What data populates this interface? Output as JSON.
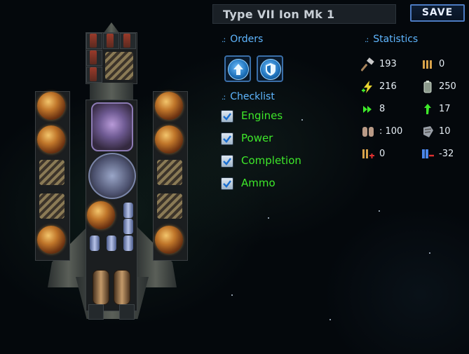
{
  "ship": {
    "name": "Type VII Ion Mk 1"
  },
  "toolbar": {
    "save_label": "SAVE"
  },
  "orders": {
    "title": "Orders",
    "buttons": [
      {
        "icon": "arrow-up-icon"
      },
      {
        "icon": "shield-icon"
      }
    ]
  },
  "checklist": {
    "title": "Checklist",
    "items": [
      {
        "label": "Engines",
        "checked": true
      },
      {
        "label": "Power",
        "checked": true
      },
      {
        "label": "Completion",
        "checked": true
      },
      {
        "label": "Ammo",
        "checked": true
      }
    ]
  },
  "statistics": {
    "title": "Statistics",
    "items": [
      {
        "icon": "hammer-icon",
        "value": "193"
      },
      {
        "icon": "ammo-crate-icon",
        "value": "0"
      },
      {
        "icon": "power-bolt-icon",
        "value": "216"
      },
      {
        "icon": "battery-icon",
        "value": "250"
      },
      {
        "icon": "thrust-chevrons-icon",
        "value": "8"
      },
      {
        "icon": "turn-arrow-icon",
        "value": "17"
      },
      {
        "icon": "armor-plates-icon",
        "value": ": 100"
      },
      {
        "icon": "repair-icon",
        "value": "10"
      },
      {
        "icon": "ammo-drain-icon",
        "value": "0"
      },
      {
        "icon": "power-drain-icon",
        "value": "-32"
      }
    ]
  },
  "colors": {
    "accent": "#5fb6ff",
    "check_text": "#3ee82a",
    "save_border": "#4c7bc2"
  }
}
